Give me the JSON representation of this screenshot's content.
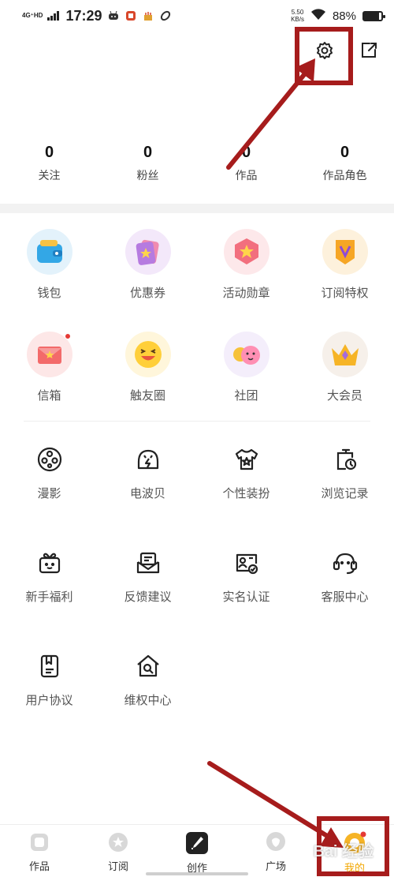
{
  "status_bar": {
    "network": "4G⁺HD",
    "time": "17:29",
    "speed_value": "5.50",
    "speed_unit": "KB/s",
    "battery_percent": "88%",
    "battery_level": 0.88
  },
  "stats": [
    {
      "value": "0",
      "label": "关注"
    },
    {
      "value": "0",
      "label": "粉丝"
    },
    {
      "value": "0",
      "label": "作品"
    },
    {
      "value": "0",
      "label": "作品角色"
    }
  ],
  "grid": {
    "row1": [
      {
        "label": "钱包",
        "icon": "wallet-icon"
      },
      {
        "label": "优惠券",
        "icon": "coupon-icon"
      },
      {
        "label": "活动勋章",
        "icon": "medal-icon"
      },
      {
        "label": "订阅特权",
        "icon": "subscription-icon"
      }
    ],
    "row2": [
      {
        "label": "信箱",
        "icon": "mailbox-icon"
      },
      {
        "label": "触友圈",
        "icon": "friends-circle-icon"
      },
      {
        "label": "社团",
        "icon": "club-icon"
      },
      {
        "label": "大会员",
        "icon": "vip-crown-icon"
      }
    ],
    "row3": [
      {
        "label": "漫影",
        "icon": "film-reel-icon"
      },
      {
        "label": "电波贝",
        "icon": "radio-shell-icon"
      },
      {
        "label": "个性装扮",
        "icon": "tshirt-icon"
      },
      {
        "label": "浏览记录",
        "icon": "history-icon"
      }
    ],
    "row4": [
      {
        "label": "新手福利",
        "icon": "gift-icon"
      },
      {
        "label": "反馈建议",
        "icon": "feedback-icon"
      },
      {
        "label": "实名认证",
        "icon": "id-card-icon"
      },
      {
        "label": "客服中心",
        "icon": "headset-icon"
      }
    ],
    "row5": [
      {
        "label": "用户协议",
        "icon": "agreement-icon"
      },
      {
        "label": "维权中心",
        "icon": "rights-house-icon"
      }
    ]
  },
  "bottom_nav": [
    {
      "label": "作品",
      "icon": "works-icon"
    },
    {
      "label": "订阅",
      "icon": "subscribe-icon"
    },
    {
      "label": "创作",
      "icon": "create-brush-icon"
    },
    {
      "label": "广场",
      "icon": "square-chat-icon"
    },
    {
      "label": "我的",
      "icon": "mine-avatar-icon"
    }
  ],
  "watermark": "Bai 经验",
  "colors": {
    "annotation_red": "#a61c1c",
    "active_tab": "#f2a600",
    "badge_red": "#e53935"
  }
}
